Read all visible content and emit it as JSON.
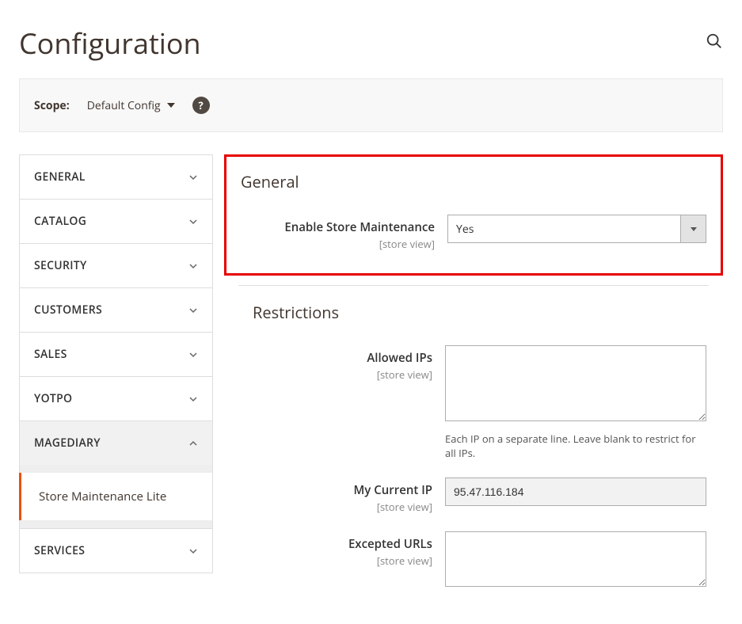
{
  "page": {
    "title": "Configuration"
  },
  "scope": {
    "label": "Scope:",
    "value": "Default Config"
  },
  "sidebar": {
    "items": [
      {
        "label": "GENERAL",
        "expanded": false
      },
      {
        "label": "CATALOG",
        "expanded": false
      },
      {
        "label": "SECURITY",
        "expanded": false
      },
      {
        "label": "CUSTOMERS",
        "expanded": false
      },
      {
        "label": "SALES",
        "expanded": false
      },
      {
        "label": "YOTPO",
        "expanded": false
      },
      {
        "label": "MAGEDIARY",
        "expanded": true,
        "subitem": "Store Maintenance Lite"
      },
      {
        "label": "SERVICES",
        "expanded": false
      }
    ]
  },
  "sections": {
    "general": {
      "heading": "General",
      "enable_maintenance": {
        "label": "Enable Store Maintenance",
        "scope": "[store view]",
        "value": "Yes"
      }
    },
    "restrictions": {
      "heading": "Restrictions",
      "allowed_ips": {
        "label": "Allowed IPs",
        "scope": "[store view]",
        "value": "",
        "help": "Each IP on a separate line. Leave blank to restrict for all IPs."
      },
      "current_ip": {
        "label": "My Current IP",
        "scope": "[store view]",
        "value": "95.47.116.184"
      },
      "excepted_urls": {
        "label": "Excepted URLs",
        "scope": "[store view]",
        "value": ""
      }
    }
  }
}
